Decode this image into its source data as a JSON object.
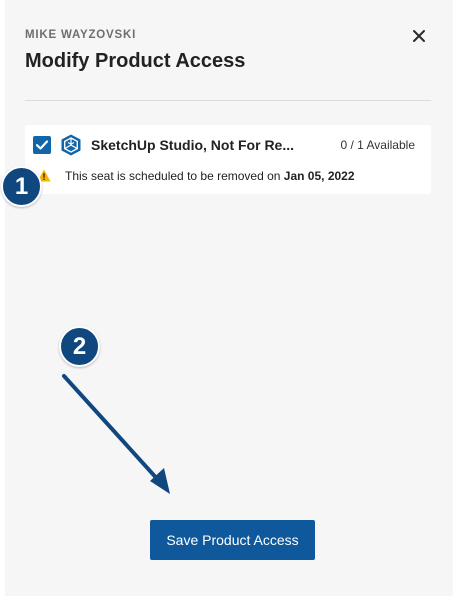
{
  "panel": {
    "user_name": "MIKE WAYZOVSKI",
    "title": "Modify Product Access",
    "close_icon": "close-icon"
  },
  "product": {
    "checked": true,
    "logo_icon": "sketchup-logo-icon",
    "name": "SketchUp Studio, Not For Re...",
    "availability": "0 / 1 Available",
    "warning_icon": "warning-icon",
    "warning_prefix": "This seat is scheduled to be removed on ",
    "warning_date": "Jan 05, 2022"
  },
  "callouts": {
    "first": "1",
    "second": "2"
  },
  "actions": {
    "save_label": "Save Product Access"
  },
  "colors": {
    "panel_background": "#f6f6f6",
    "accent": "#10589c",
    "callout": "#10477e",
    "warning": "#f5b400"
  }
}
